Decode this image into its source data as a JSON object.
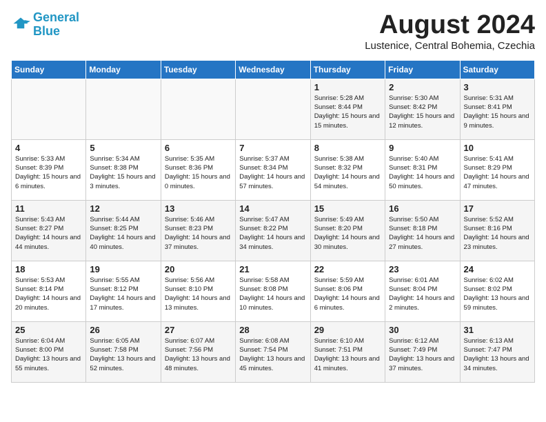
{
  "logo": {
    "line1": "General",
    "line2": "Blue"
  },
  "title": "August 2024",
  "subtitle": "Lustenice, Central Bohemia, Czechia",
  "weekdays": [
    "Sunday",
    "Monday",
    "Tuesday",
    "Wednesday",
    "Thursday",
    "Friday",
    "Saturday"
  ],
  "weeks": [
    [
      {
        "day": "",
        "info": ""
      },
      {
        "day": "",
        "info": ""
      },
      {
        "day": "",
        "info": ""
      },
      {
        "day": "",
        "info": ""
      },
      {
        "day": "1",
        "info": "Sunrise: 5:28 AM\nSunset: 8:44 PM\nDaylight: 15 hours\nand 15 minutes."
      },
      {
        "day": "2",
        "info": "Sunrise: 5:30 AM\nSunset: 8:42 PM\nDaylight: 15 hours\nand 12 minutes."
      },
      {
        "day": "3",
        "info": "Sunrise: 5:31 AM\nSunset: 8:41 PM\nDaylight: 15 hours\nand 9 minutes."
      }
    ],
    [
      {
        "day": "4",
        "info": "Sunrise: 5:33 AM\nSunset: 8:39 PM\nDaylight: 15 hours\nand 6 minutes."
      },
      {
        "day": "5",
        "info": "Sunrise: 5:34 AM\nSunset: 8:38 PM\nDaylight: 15 hours\nand 3 minutes."
      },
      {
        "day": "6",
        "info": "Sunrise: 5:35 AM\nSunset: 8:36 PM\nDaylight: 15 hours\nand 0 minutes."
      },
      {
        "day": "7",
        "info": "Sunrise: 5:37 AM\nSunset: 8:34 PM\nDaylight: 14 hours\nand 57 minutes."
      },
      {
        "day": "8",
        "info": "Sunrise: 5:38 AM\nSunset: 8:32 PM\nDaylight: 14 hours\nand 54 minutes."
      },
      {
        "day": "9",
        "info": "Sunrise: 5:40 AM\nSunset: 8:31 PM\nDaylight: 14 hours\nand 50 minutes."
      },
      {
        "day": "10",
        "info": "Sunrise: 5:41 AM\nSunset: 8:29 PM\nDaylight: 14 hours\nand 47 minutes."
      }
    ],
    [
      {
        "day": "11",
        "info": "Sunrise: 5:43 AM\nSunset: 8:27 PM\nDaylight: 14 hours\nand 44 minutes."
      },
      {
        "day": "12",
        "info": "Sunrise: 5:44 AM\nSunset: 8:25 PM\nDaylight: 14 hours\nand 40 minutes."
      },
      {
        "day": "13",
        "info": "Sunrise: 5:46 AM\nSunset: 8:23 PM\nDaylight: 14 hours\nand 37 minutes."
      },
      {
        "day": "14",
        "info": "Sunrise: 5:47 AM\nSunset: 8:22 PM\nDaylight: 14 hours\nand 34 minutes."
      },
      {
        "day": "15",
        "info": "Sunrise: 5:49 AM\nSunset: 8:20 PM\nDaylight: 14 hours\nand 30 minutes."
      },
      {
        "day": "16",
        "info": "Sunrise: 5:50 AM\nSunset: 8:18 PM\nDaylight: 14 hours\nand 27 minutes."
      },
      {
        "day": "17",
        "info": "Sunrise: 5:52 AM\nSunset: 8:16 PM\nDaylight: 14 hours\nand 23 minutes."
      }
    ],
    [
      {
        "day": "18",
        "info": "Sunrise: 5:53 AM\nSunset: 8:14 PM\nDaylight: 14 hours\nand 20 minutes."
      },
      {
        "day": "19",
        "info": "Sunrise: 5:55 AM\nSunset: 8:12 PM\nDaylight: 14 hours\nand 17 minutes."
      },
      {
        "day": "20",
        "info": "Sunrise: 5:56 AM\nSunset: 8:10 PM\nDaylight: 14 hours\nand 13 minutes."
      },
      {
        "day": "21",
        "info": "Sunrise: 5:58 AM\nSunset: 8:08 PM\nDaylight: 14 hours\nand 10 minutes."
      },
      {
        "day": "22",
        "info": "Sunrise: 5:59 AM\nSunset: 8:06 PM\nDaylight: 14 hours\nand 6 minutes."
      },
      {
        "day": "23",
        "info": "Sunrise: 6:01 AM\nSunset: 8:04 PM\nDaylight: 14 hours\nand 2 minutes."
      },
      {
        "day": "24",
        "info": "Sunrise: 6:02 AM\nSunset: 8:02 PM\nDaylight: 13 hours\nand 59 minutes."
      }
    ],
    [
      {
        "day": "25",
        "info": "Sunrise: 6:04 AM\nSunset: 8:00 PM\nDaylight: 13 hours\nand 55 minutes."
      },
      {
        "day": "26",
        "info": "Sunrise: 6:05 AM\nSunset: 7:58 PM\nDaylight: 13 hours\nand 52 minutes."
      },
      {
        "day": "27",
        "info": "Sunrise: 6:07 AM\nSunset: 7:56 PM\nDaylight: 13 hours\nand 48 minutes."
      },
      {
        "day": "28",
        "info": "Sunrise: 6:08 AM\nSunset: 7:54 PM\nDaylight: 13 hours\nand 45 minutes."
      },
      {
        "day": "29",
        "info": "Sunrise: 6:10 AM\nSunset: 7:51 PM\nDaylight: 13 hours\nand 41 minutes."
      },
      {
        "day": "30",
        "info": "Sunrise: 6:12 AM\nSunset: 7:49 PM\nDaylight: 13 hours\nand 37 minutes."
      },
      {
        "day": "31",
        "info": "Sunrise: 6:13 AM\nSunset: 7:47 PM\nDaylight: 13 hours\nand 34 minutes."
      }
    ]
  ]
}
